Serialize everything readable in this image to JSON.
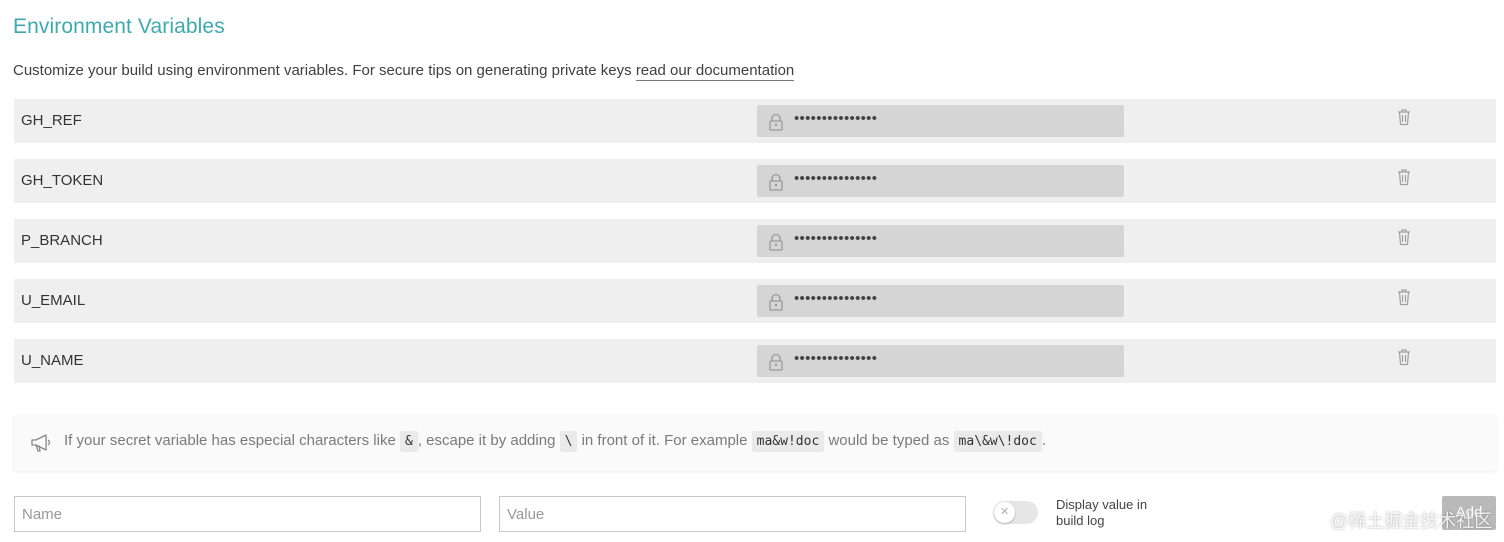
{
  "title": "Environment Variables",
  "description": {
    "text": "Customize your build using environment variables. For secure tips on generating private keys ",
    "link": "read our documentation"
  },
  "variables": [
    {
      "name": "GH_REF",
      "value": "•••••••••••••••"
    },
    {
      "name": "GH_TOKEN",
      "value": "•••••••••••••••"
    },
    {
      "name": "P_BRANCH",
      "value": "•••••••••••••••"
    },
    {
      "name": "U_EMAIL",
      "value": "•••••••••••••••"
    },
    {
      "name": "U_NAME",
      "value": "•••••••••••••••"
    }
  ],
  "notice": {
    "part1": "If your secret variable has especial characters like ",
    "code1": "&",
    "part2": ", escape it by adding ",
    "code2": "\\",
    "part3": " in front of it. For example ",
    "code3": "ma&w!doc",
    "part4": " would be typed as ",
    "code4": "ma\\&w\\!doc",
    "part5": "."
  },
  "form": {
    "name_placeholder": "Name",
    "value_placeholder": "Value",
    "display_toggle_label": "Display value in build log",
    "add_label": "Add"
  },
  "watermark": "@稀土掘金技术社区",
  "colors": {
    "title": "#3eaaaf",
    "row_bg": "#efefef",
    "secret_bg": "#d5d5d5",
    "add_button": "#b9b9b9"
  }
}
